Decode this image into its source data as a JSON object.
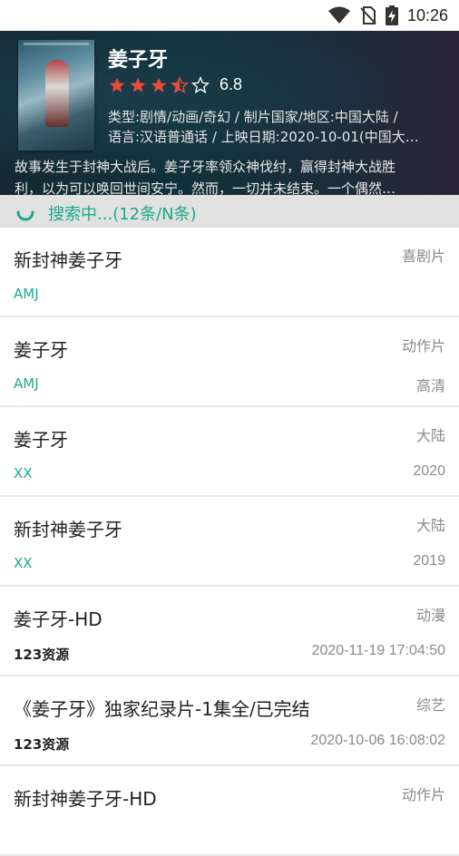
{
  "status_bar": {
    "time": "10:26",
    "icons": [
      "wifi-icon",
      "no-sim-icon",
      "battery-charging-icon"
    ]
  },
  "movie": {
    "title": "姜子牙",
    "rating": {
      "stars": 3.5,
      "max_stars": 5,
      "score": "6.8"
    },
    "meta_line1": "类型:剧情/动画/奇幻 / 制片国家/地区:中国大陆 /",
    "meta_line2": "语言:汉语普通话 / 上映日期:2020-10-01(中国大…",
    "desc_line1": "故事发生于封神大战后。姜子牙率领众神伐纣，赢得封神大战胜",
    "desc_line2": "利，以为可以唤回世间安宁。然而，一切并未结束。一个偶然…"
  },
  "search_status": "搜索中...(12条/N条)",
  "colors": {
    "accent": "#1aaa8c",
    "star": "#e84a3c"
  },
  "results": [
    {
      "name": "新封神姜子牙",
      "type": "喜剧片",
      "source": "AMJ",
      "extra": ""
    },
    {
      "name": "姜子牙",
      "type": "动作片",
      "source": "AMJ",
      "extra": "高清"
    },
    {
      "name": "姜子牙",
      "type": "大陆",
      "source": "XX",
      "extra": "2020"
    },
    {
      "name": "新封神姜子牙",
      "type": "大陆",
      "source": "XX",
      "extra": "2019"
    },
    {
      "name": "姜子牙-HD",
      "type": "动漫",
      "source": "123资源",
      "extra": "2020-11-19 17:04:50"
    },
    {
      "name": "《姜子牙》独家纪录片-1集全/已完结",
      "type": "综艺",
      "source": "123资源",
      "extra": "2020-10-06 16:08:02"
    },
    {
      "name": "新封神姜子牙-HD",
      "type": "动作片",
      "source": "",
      "extra": ""
    }
  ]
}
